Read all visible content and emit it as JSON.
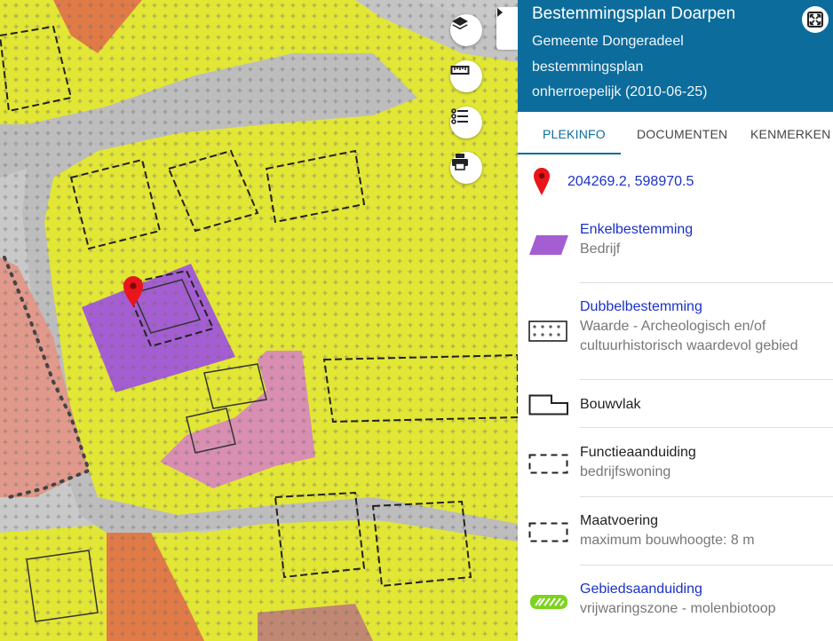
{
  "map": {
    "layers_icon": "layers-icon",
    "measure_icon": "ruler-icon",
    "legend_icon": "list-icon",
    "print_icon": "printer-icon",
    "collapse_icon": "chevron-right-icon"
  },
  "panel": {
    "title": "Bestemmingsplan Doarpen",
    "municipality": "Gemeente Dongeradeel",
    "plan_type": "bestemmingsplan",
    "status": "onherroepelijk (2010-06-25)",
    "tabs": [
      "PLEKINFO",
      "DOCUMENTEN",
      "KENMERKEN"
    ],
    "active_tab": "PLEKINFO",
    "coordinates": "204269.2, 598970.5",
    "items": [
      {
        "title": "Enkelbestemming",
        "subtitle": "Bedrijf",
        "title_is_link": true
      },
      {
        "title": "Dubbelbestemming",
        "subtitle": "Waarde - Archeologisch en/of cultuurhistorisch waardevol gebied",
        "title_is_link": true
      },
      {
        "title": "Bouwvlak",
        "subtitle": "",
        "title_is_link": false
      },
      {
        "title": "Functieaanduiding",
        "subtitle": "bedrijfswoning",
        "title_is_link": false
      },
      {
        "title": "Maatvoering",
        "subtitle": "maximum bouwhoogte: 8 m",
        "title_is_link": false
      },
      {
        "title": "Gebiedsaanduiding",
        "subtitle": "vrijwaringszone - molenbiotoop",
        "title_is_link": true
      }
    ]
  },
  "colors": {
    "header_bg": "#0c6c9c",
    "link": "#1a31c8",
    "enkelbestemming_bedrijf": "#a45ed1",
    "gebiedsaanduiding": "#7ed321",
    "map_yellow": "#e2e635",
    "map_pink": "#d88fb2",
    "map_orange": "#e07a47",
    "marker_red": "#e8151a"
  }
}
